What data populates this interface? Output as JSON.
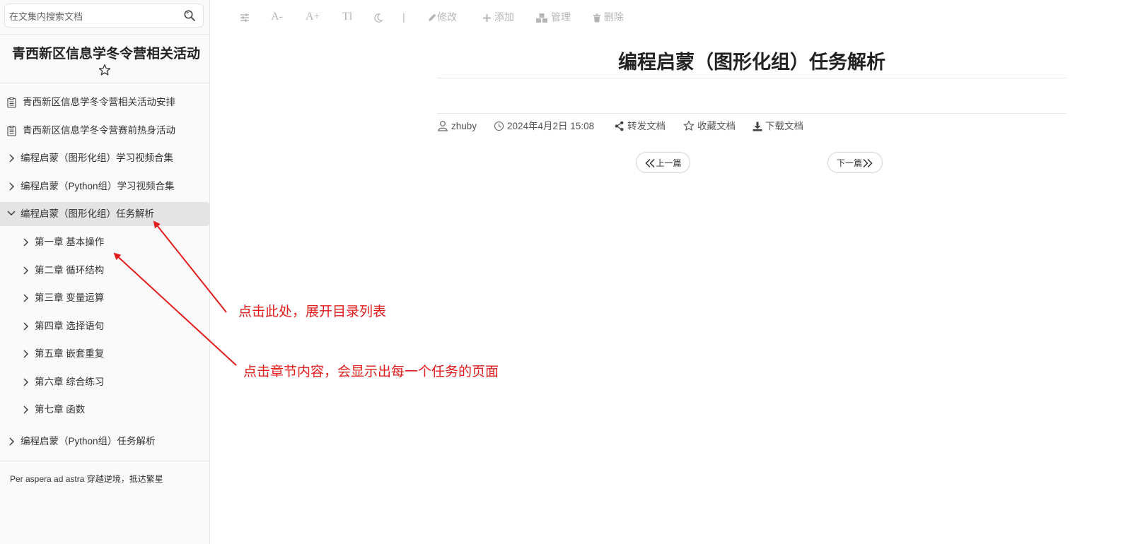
{
  "search": {
    "placeholder": "在文集内搜索文档"
  },
  "sidebar": {
    "project_title": "青西新区信息学冬令营相关活动",
    "items": [
      {
        "label": "青西新区信息学冬令营相关活动安排",
        "type": "doc"
      },
      {
        "label": "青西新区信息学冬令营赛前热身活动",
        "type": "doc"
      },
      {
        "label": "编程启蒙（图形化组）学习视频合集",
        "type": "folder"
      },
      {
        "label": "编程启蒙（Python组）学习视频合集",
        "type": "folder"
      },
      {
        "label": "编程启蒙（图形化组）任务解析",
        "type": "folder-open",
        "active": true
      },
      {
        "label": "第一章 基本操作",
        "type": "folder"
      },
      {
        "label": "第二章 循环结构",
        "type": "folder"
      },
      {
        "label": "第三章 变量运算",
        "type": "folder"
      },
      {
        "label": "第四章 选择语句",
        "type": "folder"
      },
      {
        "label": "第五章 嵌套重复",
        "type": "folder"
      },
      {
        "label": "第六章 综合练习",
        "type": "folder"
      },
      {
        "label": "第七章 函数",
        "type": "folder"
      },
      {
        "label": "编程启蒙（Python组）任务解析",
        "type": "folder"
      }
    ],
    "footer": "Per aspera ad astra 穿越逆境，抵达繁星"
  },
  "toolbar": {
    "font_decrease": "A-",
    "font_increase": "A+",
    "font_switch": "Tl",
    "separator": "|",
    "edit": "修改",
    "add": "添加",
    "manage": "管理",
    "delete": "删除"
  },
  "doc": {
    "title": "编程启蒙（图形化组）任务解析",
    "author": "zhuby",
    "date": "2024年4月2日 15:08",
    "share": "转发文档",
    "collect": "收藏文档",
    "download": "下载文档",
    "prev": "上一篇",
    "next": "下一篇"
  },
  "annotations": {
    "note1": "点击此处，展开目录列表",
    "note2": "点击章节内容，会显示出每一个任务的页面",
    "color": "#e21b1b"
  },
  "colors": {
    "sidebar_bg": "#fafafa",
    "active_item_bg": "#e4e4e4",
    "toolbar_icon": "#b5b5b5"
  }
}
